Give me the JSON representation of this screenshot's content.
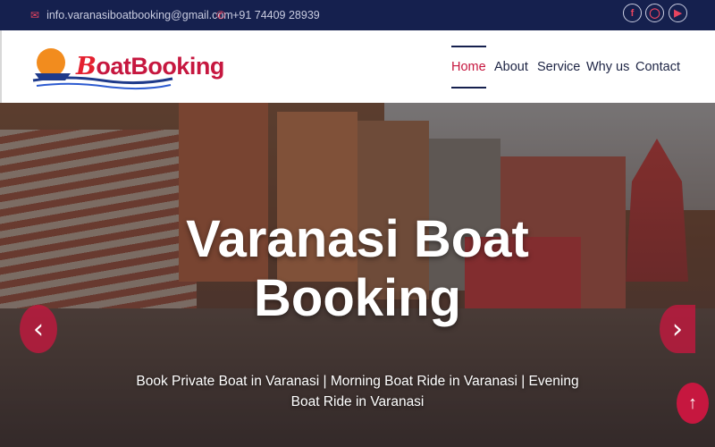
{
  "topbar": {
    "email": "info.varanasiboatbooking@gmail.com",
    "phone": "+91 74409 28939",
    "social": [
      "facebook-icon",
      "instagram-icon",
      "youtube-icon"
    ]
  },
  "brand": {
    "logo_b": "B",
    "logo_rest": "oatBooking"
  },
  "nav": {
    "items": [
      "Home",
      "About",
      "Service",
      "Why us",
      "Contact"
    ],
    "active": "Home"
  },
  "hero": {
    "title": "Varanasi Boat Booking",
    "subtitle": "Book Private Boat in Varanasi | Morning Boat Ride in Varanasi | Evening Boat Ride in Varanasi"
  },
  "colors": {
    "topbar_bg": "#15204e",
    "accent": "#c6173f"
  }
}
